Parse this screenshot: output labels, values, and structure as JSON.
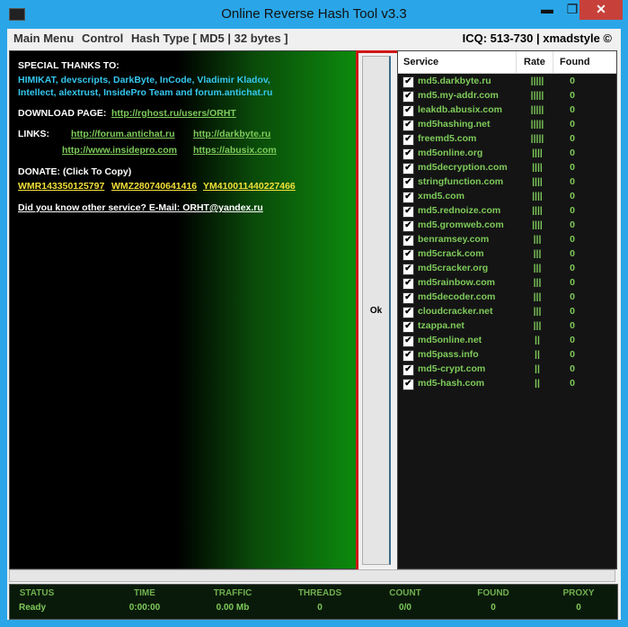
{
  "window": {
    "title": "Online Reverse Hash Tool v3.3",
    "min_symbol": "▬",
    "max_symbol": "❐",
    "close_symbol": "✕"
  },
  "menu": {
    "items": [
      "Main Menu",
      "Control",
      "Hash Type [ MD5 | 32 bytes ]"
    ],
    "icq": "ICQ: 513-730 | xmadstyle ©"
  },
  "about": {
    "thanks_heading": "SPECIAL THANKS TO:",
    "thanks_line1": "HIMIKAT, devscripts, DarkByte, InCode, Vladimir Kladov,",
    "thanks_line2": "Intellect, alextrust, InsidePro Team and forum.antichat.ru",
    "download_label": "DOWNLOAD PAGE:",
    "download_link": "http://rghost.ru/users/ORHT",
    "links_label": "LINKS:",
    "links": [
      "http://forum.antichat.ru",
      "http://darkbyte.ru",
      "http://www.insidepro.com",
      "https://abusix.com"
    ],
    "donate_label": "DONATE: (Click To Copy)",
    "wallets": [
      "WMR143350125797",
      "WMZ280740641416",
      "YM410011440227466"
    ],
    "contact": "Did you know other service? E-Mail: ORHT@yandex.ru"
  },
  "ok_button": "Ok",
  "services": {
    "headers": {
      "service": "Service",
      "rate": "Rate",
      "found": "Found"
    },
    "check_mark": "✔",
    "rows": [
      {
        "name": "md5.darkbyte.ru",
        "rate": "|||||",
        "found": "0"
      },
      {
        "name": "md5.my-addr.com",
        "rate": "|||||",
        "found": "0"
      },
      {
        "name": "leakdb.abusix.com",
        "rate": "|||||",
        "found": "0"
      },
      {
        "name": "md5hashing.net",
        "rate": "|||||",
        "found": "0"
      },
      {
        "name": "freemd5.com",
        "rate": "|||||",
        "found": "0"
      },
      {
        "name": "md5online.org",
        "rate": "||||",
        "found": "0"
      },
      {
        "name": "md5decryption.com",
        "rate": "||||",
        "found": "0"
      },
      {
        "name": "stringfunction.com",
        "rate": "||||",
        "found": "0"
      },
      {
        "name": "xmd5.com",
        "rate": "||||",
        "found": "0"
      },
      {
        "name": "md5.rednoize.com",
        "rate": "||||",
        "found": "0"
      },
      {
        "name": "md5.gromweb.com",
        "rate": "||||",
        "found": "0"
      },
      {
        "name": "benramsey.com",
        "rate": "|||",
        "found": "0"
      },
      {
        "name": "md5crack.com",
        "rate": "|||",
        "found": "0"
      },
      {
        "name": "md5cracker.org",
        "rate": "|||",
        "found": "0"
      },
      {
        "name": "md5rainbow.com",
        "rate": "|||",
        "found": "0"
      },
      {
        "name": "md5decoder.com",
        "rate": "|||",
        "found": "0"
      },
      {
        "name": "cloudcracker.net",
        "rate": "|||",
        "found": "0"
      },
      {
        "name": "tzappa.net",
        "rate": "|||",
        "found": "0"
      },
      {
        "name": "md5online.net",
        "rate": "||",
        "found": "0"
      },
      {
        "name": "md5pass.info",
        "rate": "||",
        "found": "0"
      },
      {
        "name": "md5-crypt.com",
        "rate": "||",
        "found": "0"
      },
      {
        "name": "md5-hash.com",
        "rate": "||",
        "found": "0"
      }
    ]
  },
  "status": {
    "labels": [
      "STATUS",
      "TIME",
      "TRAFFIC",
      "THREADS",
      "COUNT",
      "FOUND",
      "PROXY"
    ],
    "values": [
      "Ready",
      "0:00:00",
      "0.00 Mb",
      "0",
      "0/0",
      "0",
      "0"
    ]
  }
}
